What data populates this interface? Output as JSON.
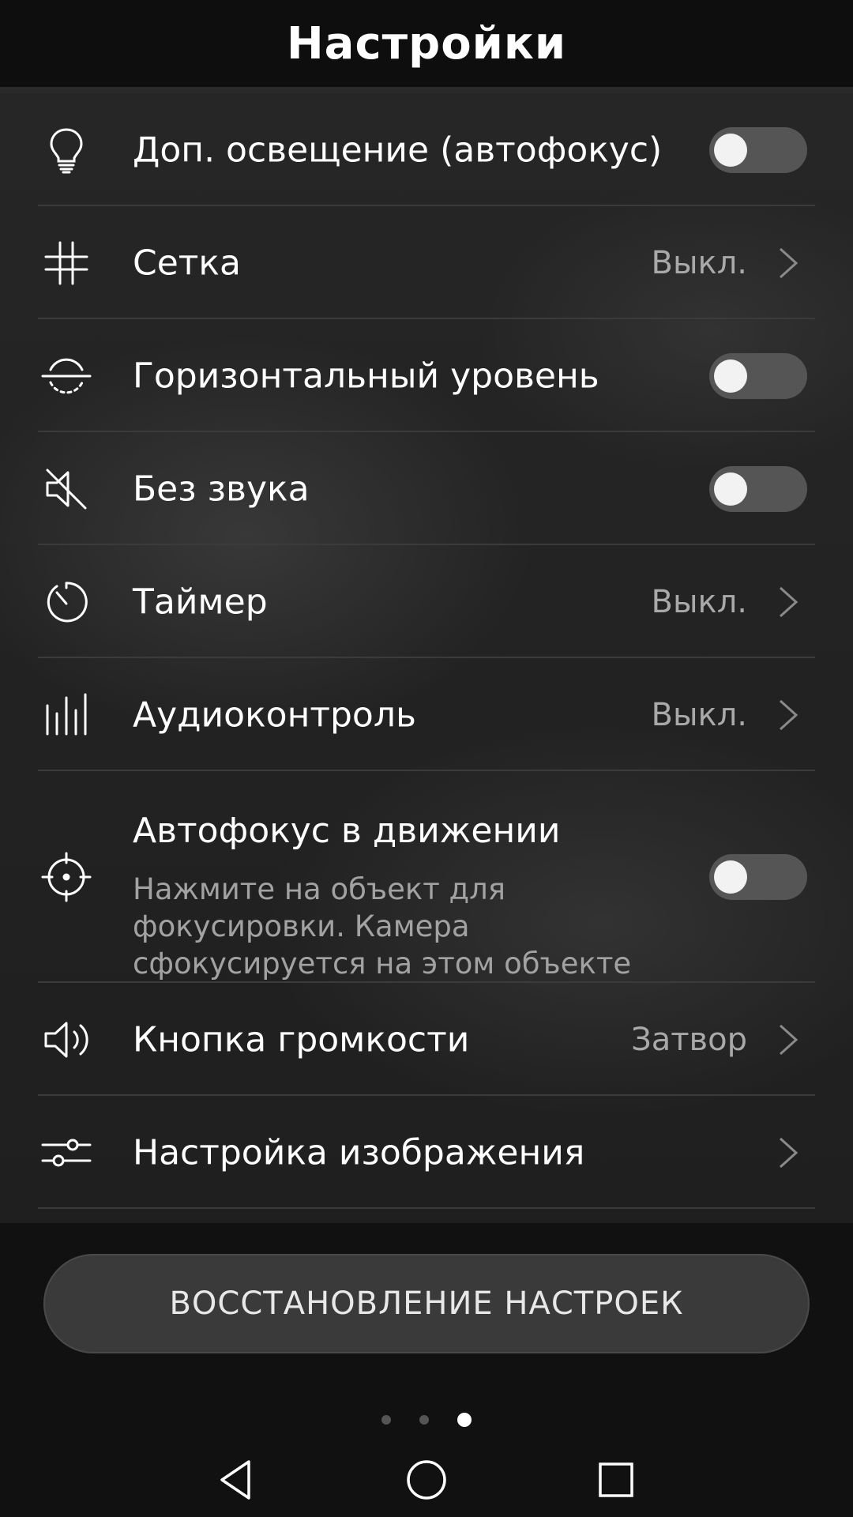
{
  "header": {
    "title": "Настройки"
  },
  "settings": [
    {
      "label": "Доп. освещение (автофокус)",
      "icon": "bulb-icon",
      "control": "toggle",
      "enabled": false
    },
    {
      "label": "Сетка",
      "icon": "grid-icon",
      "control": "value",
      "value": "Выкл."
    },
    {
      "label": "Горизонтальный уровень",
      "icon": "level-icon",
      "control": "toggle",
      "enabled": false
    },
    {
      "label": "Без звука",
      "icon": "mute-icon",
      "control": "toggle",
      "enabled": false
    },
    {
      "label": "Таймер",
      "icon": "timer-icon",
      "control": "value",
      "value": "Выкл."
    },
    {
      "label": "Аудиоконтроль",
      "icon": "audio-bars-icon",
      "control": "value",
      "value": "Выкл."
    },
    {
      "label": "Автофокус в движении",
      "icon": "crosshair-icon",
      "control": "toggle",
      "enabled": false,
      "description": "Нажмите на объект для фокусировки. Камера сфокусируется на этом объекте"
    },
    {
      "label": "Кнопка громкости",
      "icon": "speaker-icon",
      "control": "value",
      "value": "Затвор"
    },
    {
      "label": "Настройка изображения",
      "icon": "sliders-icon",
      "control": "chevron"
    }
  ],
  "reset_button": {
    "label": "ВОССТАНОВЛЕНИЕ НАСТРОЕК"
  },
  "pager": {
    "count": 3,
    "active_index": 2
  },
  "navbar": {
    "back_icon": "back-triangle-icon",
    "home_icon": "home-circle-icon",
    "recents_icon": "recents-square-icon"
  },
  "colors": {
    "background": "#111111",
    "toggle_off": "#555555",
    "value_text": "#a9a9a9"
  }
}
